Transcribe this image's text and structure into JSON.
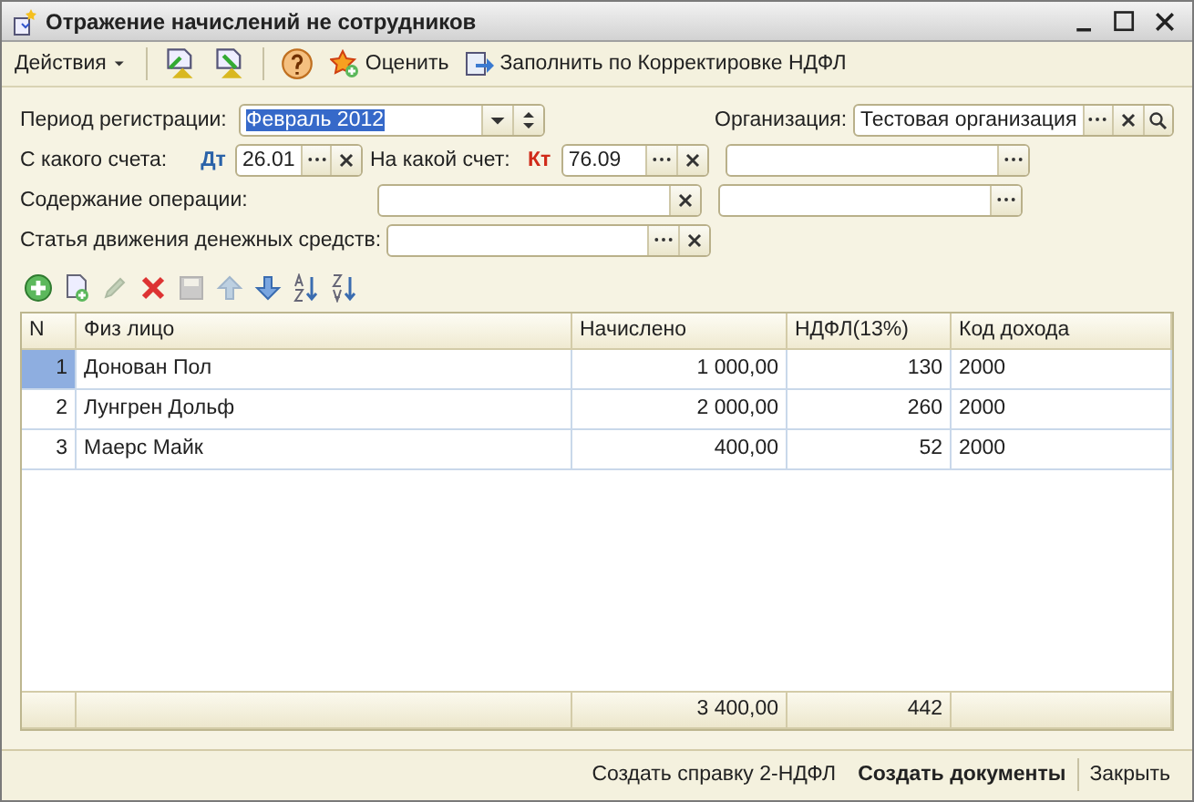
{
  "window": {
    "title": "Отражение начислений не сотрудников"
  },
  "toolbar": {
    "actions_label": "Действия",
    "buttons": [
      {
        "kind": "rate",
        "label": "Оценить"
      },
      {
        "kind": "fill",
        "label": "Заполнить по Корректировке НДФЛ"
      }
    ]
  },
  "form": {
    "period": {
      "label": "Период регистрации:",
      "value": "Февраль 2012",
      "text_selected": true
    },
    "organization": {
      "label": "Организация:",
      "value": "Тестовая организация"
    },
    "debit": {
      "label": "С какого счета:",
      "mark": "Дт",
      "value": "26.01"
    },
    "credit": {
      "label": "На какой счет:",
      "mark": "Кт",
      "value": "76.09"
    },
    "content": {
      "label": "Содержание операции:"
    },
    "cashflow": {
      "label": "Статья движения денежных средств:"
    }
  },
  "table_toolbar": [
    {
      "kind": "add",
      "disabled": false
    },
    {
      "kind": "copy",
      "disabled": false
    },
    {
      "kind": "edit",
      "disabled": true
    },
    {
      "kind": "delete",
      "disabled": false
    },
    {
      "kind": "save",
      "disabled": true
    },
    {
      "kind": "up",
      "disabled": true
    },
    {
      "kind": "down",
      "disabled": false
    },
    {
      "kind": "sort-asc",
      "disabled": false
    },
    {
      "kind": "sort-desc",
      "disabled": false
    }
  ],
  "table": {
    "columns": [
      "N",
      "Физ лицо",
      "Начислено",
      "НДФЛ(13%)",
      "Код дохода"
    ],
    "rows": [
      {
        "n": "1",
        "person": "Донован Пол",
        "accrued": "1 000,00",
        "ndfl": "130",
        "code": "2000",
        "selected": true
      },
      {
        "n": "2",
        "person": "Лунгрен Дольф",
        "accrued": "2 000,00",
        "ndfl": "260",
        "code": "2000",
        "selected": false
      },
      {
        "n": "3",
        "person": "Маерс Майк",
        "accrued": "400,00",
        "ndfl": "52",
        "code": "2000",
        "selected": false
      }
    ],
    "totals": {
      "accrued": "3 400,00",
      "ndfl": "442"
    }
  },
  "footer_buttons": [
    {
      "label": "Создать справку 2-НДФЛ",
      "default": false
    },
    {
      "label": "Создать документы",
      "default": true
    },
    {
      "label": "Закрыть",
      "default": false
    }
  ]
}
